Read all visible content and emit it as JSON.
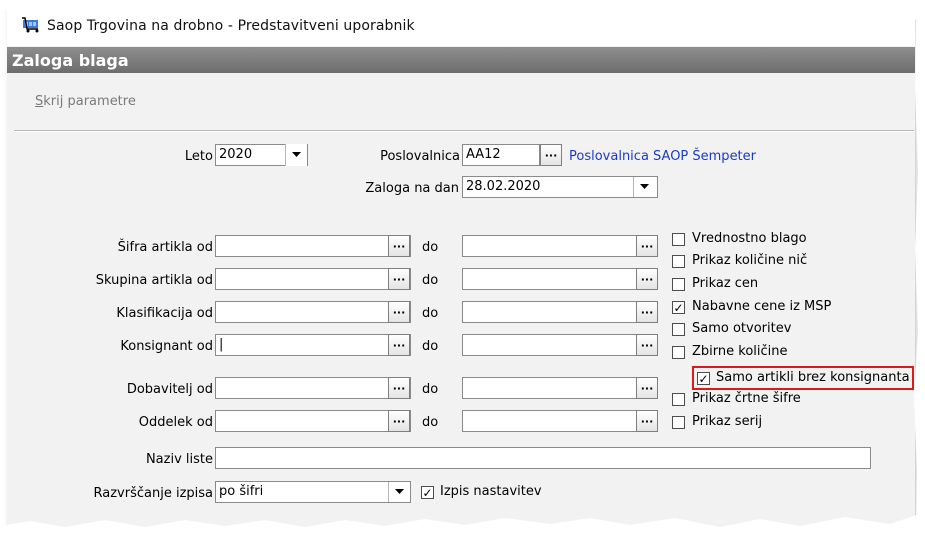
{
  "window": {
    "title": "Saop Trgovina na drobno - Predstavitveni uporabnik"
  },
  "form": {
    "title": "Zaloga blaga",
    "skrij_underline": "S",
    "skrij_rest": "krij parametre"
  },
  "leto": {
    "label": "Leto",
    "value": "2020"
  },
  "poslovalnica": {
    "label": "Poslovalnica",
    "code": "AA12",
    "name": "Poslovalnica SAOP Šempeter"
  },
  "zaloga_na_dan": {
    "label": "Zaloga na dan",
    "value": "28.02.2020"
  },
  "ranges": [
    {
      "label": "Šifra artikla od",
      "from": "",
      "do_label": "do",
      "to": ""
    },
    {
      "label": "Skupina artikla od",
      "from": "",
      "do_label": "do",
      "to": ""
    },
    {
      "label": "Klasifikacija od",
      "from": "",
      "do_label": "do",
      "to": ""
    },
    {
      "label": "Konsignant od",
      "from": "|",
      "do_label": "do",
      "to": ""
    },
    {
      "label": "Dobavitelj od",
      "from": "",
      "do_label": "do",
      "to": ""
    },
    {
      "label": "Oddelek od",
      "from": "",
      "do_label": "do",
      "to": ""
    }
  ],
  "options": [
    {
      "label": "Vrednostno blago",
      "checked": false
    },
    {
      "label": "Prikaz količine nič",
      "checked": false
    },
    {
      "label": "Prikaz cen",
      "checked": false
    },
    {
      "label": "Nabavne cene iz MSP",
      "checked": true
    },
    {
      "label": "Samo otvoritev",
      "checked": false
    },
    {
      "label": "Zbirne količine",
      "checked": false
    },
    {
      "label": "Samo artikli brez konsignanta",
      "checked": true
    },
    {
      "label": "Prikaz črtne šifre",
      "checked": false
    },
    {
      "label": "Prikaz serij",
      "checked": false
    }
  ],
  "naziv_liste": {
    "label": "Naziv liste",
    "value": ""
  },
  "razvrscanje": {
    "label": "Razvrščanje izpisa",
    "value": "po šifri"
  },
  "izpis_nastavitev": {
    "label": "Izpis nastavitev",
    "checked": true
  },
  "icons": {
    "browse": "ellipsis-button-icon",
    "dropdown": "chevron-down-icon",
    "check": "check-icon",
    "app": "shopping-cart-icon"
  },
  "colors": {
    "header_bg": "#7a7a7a",
    "header_text": "#ffffff",
    "link": "#1a3ac8",
    "highlight": "#d81b1b",
    "form_bg": "#f2f2f2"
  }
}
